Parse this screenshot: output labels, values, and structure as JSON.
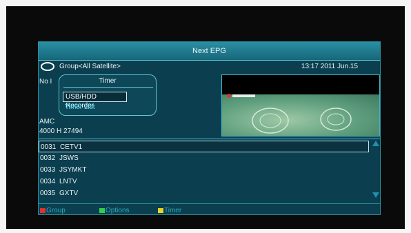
{
  "title": "Next EPG",
  "group": {
    "label": "Group<All Satellite>",
    "datetime": "13:17 2011 Jun.15"
  },
  "info": {
    "no_info": "No I",
    "satellite": "AMC",
    "transponder": "4000 H 27494"
  },
  "popup": {
    "title": "Timer",
    "items": [
      "USB/HDD Recorder",
      "Timer List"
    ]
  },
  "channels": [
    {
      "num": "0031",
      "name": "CETV1"
    },
    {
      "num": "0032",
      "name": "JSWS"
    },
    {
      "num": "0033",
      "name": "JSYMKT"
    },
    {
      "num": "0034",
      "name": "LNTV"
    },
    {
      "num": "0035",
      "name": "GXTV"
    }
  ],
  "footer": [
    {
      "label": "Group",
      "color": "#e23030"
    },
    {
      "label": "Options",
      "color": "#2fd04a"
    },
    {
      "label": "Timer",
      "color": "#e8d52a"
    }
  ]
}
